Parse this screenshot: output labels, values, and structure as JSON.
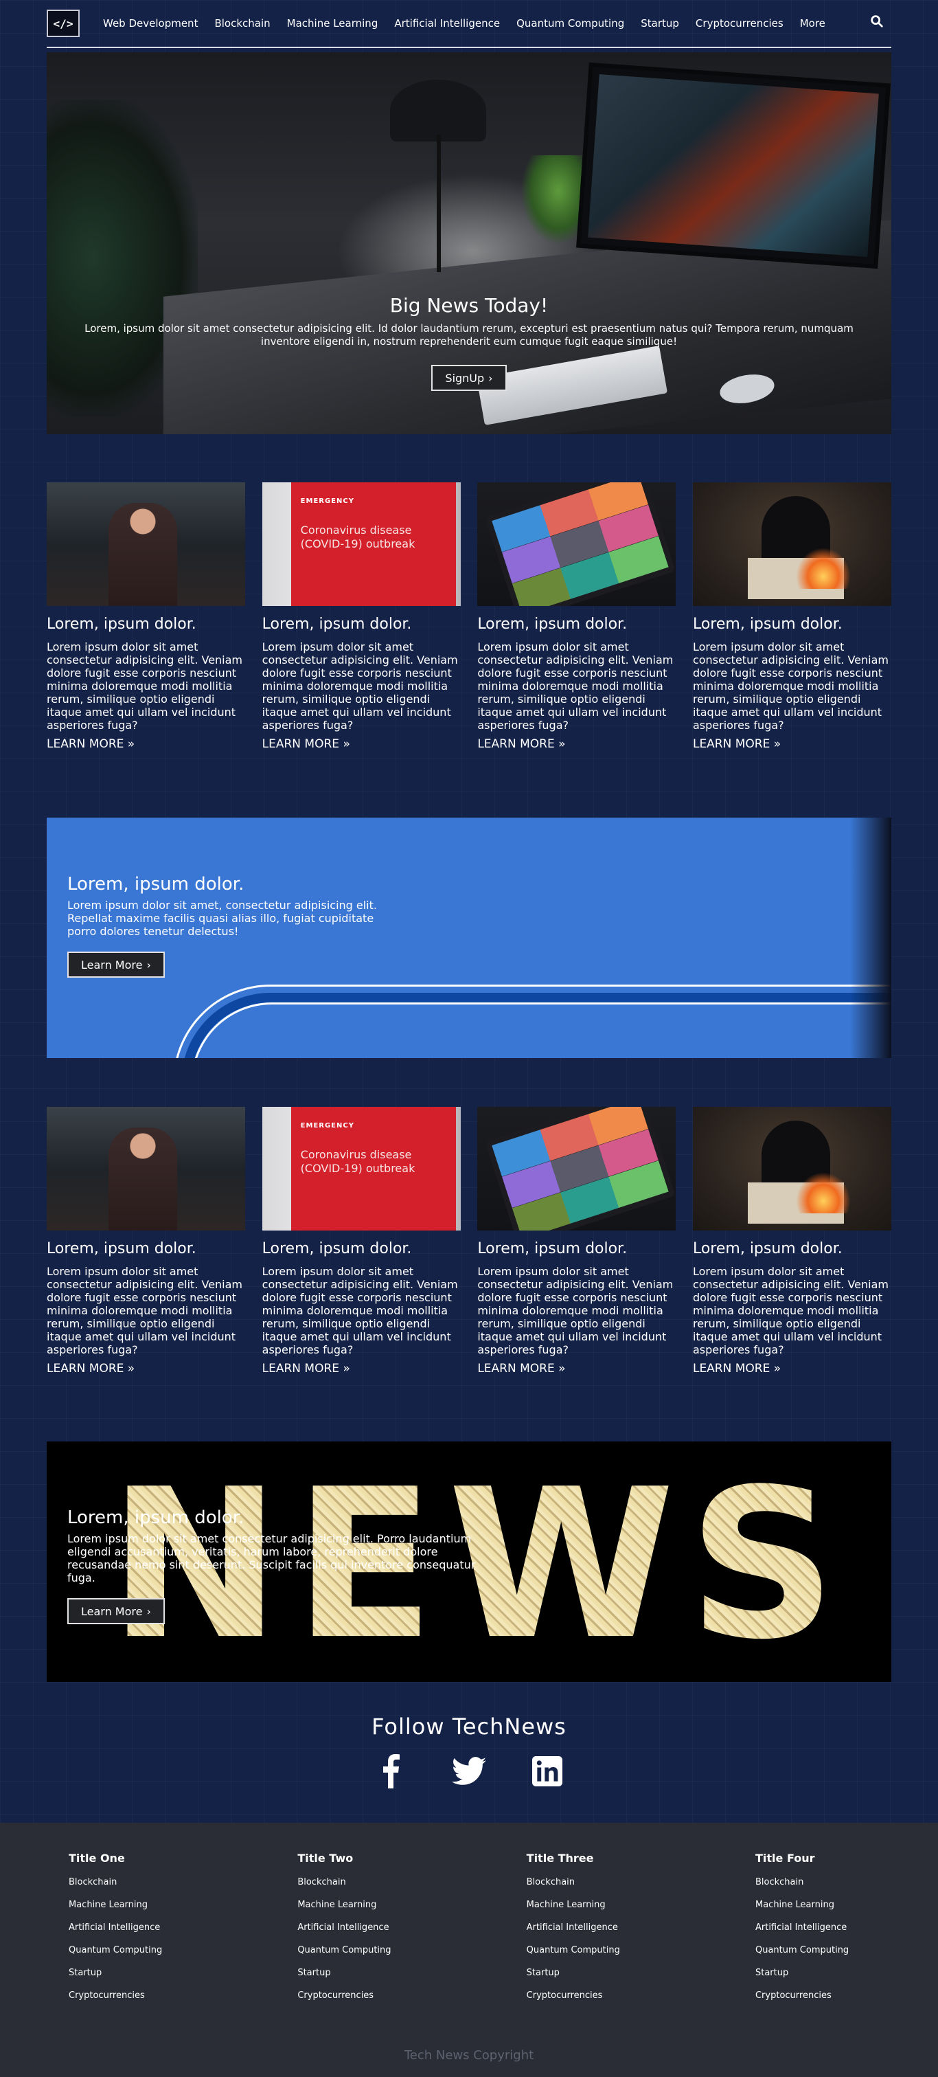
{
  "nav": {
    "logo": "</>",
    "items": [
      "Web Development",
      "Blockchain",
      "Machine Learning",
      "Artificial Intelligence",
      "Quantum Computing",
      "Startup",
      "Cryptocurrencies",
      "More"
    ]
  },
  "hero": {
    "title": "Big News Today!",
    "text": "Lorem, ipsum dolor sit amet consectetur adipisicing elit. Id dolor laudantium rerum, excepturi est praesentium natus qui? Tempora rerum, numquam inventore eligendi in, nostrum reprehenderit eum cumque fugit eaque similique!",
    "button": "SignUp"
  },
  "cards_top": [
    {
      "title": "Lorem, ipsum dolor.",
      "text": "Lorem ipsum dolor sit amet consectetur adipisicing elit. Veniam dolore fugit esse corporis nesciunt minima doloremque modi mollitia rerum, similique optio eligendi itaque amet qui ullam vel incidunt asperiores fuga?",
      "link": "LEARN MORE"
    },
    {
      "title": "Lorem, ipsum dolor.",
      "text": "Lorem ipsum dolor sit amet consectetur adipisicing elit. Veniam dolore fugit esse corporis nesciunt minima doloremque modi mollitia rerum, similique optio eligendi itaque amet qui ullam vel incidunt asperiores fuga?",
      "link": "LEARN MORE"
    },
    {
      "title": "Lorem, ipsum dolor.",
      "text": "Lorem ipsum dolor sit amet consectetur adipisicing elit. Veniam dolore fugit esse corporis nesciunt minima doloremque modi mollitia rerum, similique optio eligendi itaque amet qui ullam vel incidunt asperiores fuga?",
      "link": "LEARN MORE"
    },
    {
      "title": "Lorem, ipsum dolor.",
      "text": "Lorem ipsum dolor sit amet consectetur adipisicing elit. Veniam dolore fugit esse corporis nesciunt minima doloremque modi mollitia rerum, similique optio eligendi itaque amet qui ullam vel incidunt asperiores fuga?",
      "link": "LEARN MORE"
    }
  ],
  "emergency_image": {
    "tag": "EMERGENCY",
    "text": "Coronavirus disease (COVID-19) outbreak"
  },
  "promo1": {
    "title": "Lorem, ipsum dolor.",
    "text": "Lorem ipsum dolor sit amet, consectetur adipisicing elit. Repellat maxime facilis quasi alias illo, fugiat cupiditate porro dolores tenetur delectus!",
    "button": "Learn More"
  },
  "cards_bottom": [
    {
      "title": "Lorem, ipsum dolor.",
      "text": "Lorem ipsum dolor sit amet consectetur adipisicing elit. Veniam dolore fugit esse corporis nesciunt minima doloremque modi mollitia rerum, similique optio eligendi itaque amet qui ullam vel incidunt asperiores fuga?",
      "link": "LEARN MORE"
    },
    {
      "title": "Lorem, ipsum dolor.",
      "text": "Lorem ipsum dolor sit amet consectetur adipisicing elit. Veniam dolore fugit esse corporis nesciunt minima doloremque modi mollitia rerum, similique optio eligendi itaque amet qui ullam vel incidunt asperiores fuga?",
      "link": "LEARN MORE"
    },
    {
      "title": "Lorem, ipsum dolor.",
      "text": "Lorem ipsum dolor sit amet consectetur adipisicing elit. Veniam dolore fugit esse corporis nesciunt minima doloremque modi mollitia rerum, similique optio eligendi itaque amet qui ullam vel incidunt asperiores fuga?",
      "link": "LEARN MORE"
    },
    {
      "title": "Lorem, ipsum dolor.",
      "text": "Lorem ipsum dolor sit amet consectetur adipisicing elit. Veniam dolore fugit esse corporis nesciunt minima doloremque modi mollitia rerum, similique optio eligendi itaque amet qui ullam vel incidunt asperiores fuga?",
      "link": "LEARN MORE"
    }
  ],
  "promo2": {
    "letters": [
      "N",
      "E",
      "W",
      "S"
    ],
    "title": "Lorem, ipsum dolor.",
    "text": "Lorem ipsum dolor sit amet consectetur adipisicing elit. Porro laudantium eligendi accusantium, veritatis, harum labore, reprehenderit dolore recusandae nemo sint deserunt. Suscipit facilis qui inventore consequatur fuga.",
    "button": "Learn More"
  },
  "follow": {
    "title": "Follow TechNews",
    "icons": [
      "facebook-icon",
      "twitter-icon",
      "linkedin-icon"
    ]
  },
  "footer": {
    "columns": [
      {
        "title": "Title One",
        "links": [
          "Blockchain",
          "Machine Learning",
          "Artificial Intelligence",
          "Quantum Computing",
          "Startup",
          "Cryptocurrencies"
        ]
      },
      {
        "title": "Title Two",
        "links": [
          "Blockchain",
          "Machine Learning",
          "Artificial Intelligence",
          "Quantum Computing",
          "Startup",
          "Cryptocurrencies"
        ]
      },
      {
        "title": "Title Three",
        "links": [
          "Blockchain",
          "Machine Learning",
          "Artificial Intelligence",
          "Quantum Computing",
          "Startup",
          "Cryptocurrencies"
        ]
      },
      {
        "title": "Title Four",
        "links": [
          "Blockchain",
          "Machine Learning",
          "Artificial Intelligence",
          "Quantum Computing",
          "Startup",
          "Cryptocurrencies"
        ]
      }
    ],
    "copyright": "Tech News Copyright"
  },
  "colors": {
    "page_bg": "#142247",
    "promo_blue": "#3a77d4",
    "footer_bg": "#2a2d35",
    "button_bg": "#222326"
  }
}
